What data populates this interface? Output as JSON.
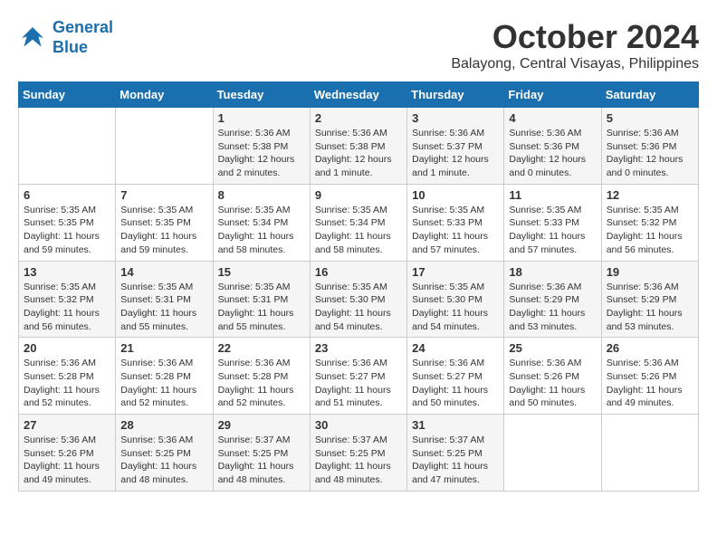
{
  "logo": {
    "line1": "General",
    "line2": "Blue"
  },
  "title": "October 2024",
  "location": "Balayong, Central Visayas, Philippines",
  "weekdays": [
    "Sunday",
    "Monday",
    "Tuesday",
    "Wednesday",
    "Thursday",
    "Friday",
    "Saturday"
  ],
  "weeks": [
    [
      {
        "day": "",
        "info": ""
      },
      {
        "day": "",
        "info": ""
      },
      {
        "day": "1",
        "info": "Sunrise: 5:36 AM\nSunset: 5:38 PM\nDaylight: 12 hours\nand 2 minutes."
      },
      {
        "day": "2",
        "info": "Sunrise: 5:36 AM\nSunset: 5:38 PM\nDaylight: 12 hours\nand 1 minute."
      },
      {
        "day": "3",
        "info": "Sunrise: 5:36 AM\nSunset: 5:37 PM\nDaylight: 12 hours\nand 1 minute."
      },
      {
        "day": "4",
        "info": "Sunrise: 5:36 AM\nSunset: 5:36 PM\nDaylight: 12 hours\nand 0 minutes."
      },
      {
        "day": "5",
        "info": "Sunrise: 5:36 AM\nSunset: 5:36 PM\nDaylight: 12 hours\nand 0 minutes."
      }
    ],
    [
      {
        "day": "6",
        "info": "Sunrise: 5:35 AM\nSunset: 5:35 PM\nDaylight: 11 hours\nand 59 minutes."
      },
      {
        "day": "7",
        "info": "Sunrise: 5:35 AM\nSunset: 5:35 PM\nDaylight: 11 hours\nand 59 minutes."
      },
      {
        "day": "8",
        "info": "Sunrise: 5:35 AM\nSunset: 5:34 PM\nDaylight: 11 hours\nand 58 minutes."
      },
      {
        "day": "9",
        "info": "Sunrise: 5:35 AM\nSunset: 5:34 PM\nDaylight: 11 hours\nand 58 minutes."
      },
      {
        "day": "10",
        "info": "Sunrise: 5:35 AM\nSunset: 5:33 PM\nDaylight: 11 hours\nand 57 minutes."
      },
      {
        "day": "11",
        "info": "Sunrise: 5:35 AM\nSunset: 5:33 PM\nDaylight: 11 hours\nand 57 minutes."
      },
      {
        "day": "12",
        "info": "Sunrise: 5:35 AM\nSunset: 5:32 PM\nDaylight: 11 hours\nand 56 minutes."
      }
    ],
    [
      {
        "day": "13",
        "info": "Sunrise: 5:35 AM\nSunset: 5:32 PM\nDaylight: 11 hours\nand 56 minutes."
      },
      {
        "day": "14",
        "info": "Sunrise: 5:35 AM\nSunset: 5:31 PM\nDaylight: 11 hours\nand 55 minutes."
      },
      {
        "day": "15",
        "info": "Sunrise: 5:35 AM\nSunset: 5:31 PM\nDaylight: 11 hours\nand 55 minutes."
      },
      {
        "day": "16",
        "info": "Sunrise: 5:35 AM\nSunset: 5:30 PM\nDaylight: 11 hours\nand 54 minutes."
      },
      {
        "day": "17",
        "info": "Sunrise: 5:35 AM\nSunset: 5:30 PM\nDaylight: 11 hours\nand 54 minutes."
      },
      {
        "day": "18",
        "info": "Sunrise: 5:36 AM\nSunset: 5:29 PM\nDaylight: 11 hours\nand 53 minutes."
      },
      {
        "day": "19",
        "info": "Sunrise: 5:36 AM\nSunset: 5:29 PM\nDaylight: 11 hours\nand 53 minutes."
      }
    ],
    [
      {
        "day": "20",
        "info": "Sunrise: 5:36 AM\nSunset: 5:28 PM\nDaylight: 11 hours\nand 52 minutes."
      },
      {
        "day": "21",
        "info": "Sunrise: 5:36 AM\nSunset: 5:28 PM\nDaylight: 11 hours\nand 52 minutes."
      },
      {
        "day": "22",
        "info": "Sunrise: 5:36 AM\nSunset: 5:28 PM\nDaylight: 11 hours\nand 52 minutes."
      },
      {
        "day": "23",
        "info": "Sunrise: 5:36 AM\nSunset: 5:27 PM\nDaylight: 11 hours\nand 51 minutes."
      },
      {
        "day": "24",
        "info": "Sunrise: 5:36 AM\nSunset: 5:27 PM\nDaylight: 11 hours\nand 50 minutes."
      },
      {
        "day": "25",
        "info": "Sunrise: 5:36 AM\nSunset: 5:26 PM\nDaylight: 11 hours\nand 50 minutes."
      },
      {
        "day": "26",
        "info": "Sunrise: 5:36 AM\nSunset: 5:26 PM\nDaylight: 11 hours\nand 49 minutes."
      }
    ],
    [
      {
        "day": "27",
        "info": "Sunrise: 5:36 AM\nSunset: 5:26 PM\nDaylight: 11 hours\nand 49 minutes."
      },
      {
        "day": "28",
        "info": "Sunrise: 5:36 AM\nSunset: 5:25 PM\nDaylight: 11 hours\nand 48 minutes."
      },
      {
        "day": "29",
        "info": "Sunrise: 5:37 AM\nSunset: 5:25 PM\nDaylight: 11 hours\nand 48 minutes."
      },
      {
        "day": "30",
        "info": "Sunrise: 5:37 AM\nSunset: 5:25 PM\nDaylight: 11 hours\nand 48 minutes."
      },
      {
        "day": "31",
        "info": "Sunrise: 5:37 AM\nSunset: 5:25 PM\nDaylight: 11 hours\nand 47 minutes."
      },
      {
        "day": "",
        "info": ""
      },
      {
        "day": "",
        "info": ""
      }
    ]
  ]
}
